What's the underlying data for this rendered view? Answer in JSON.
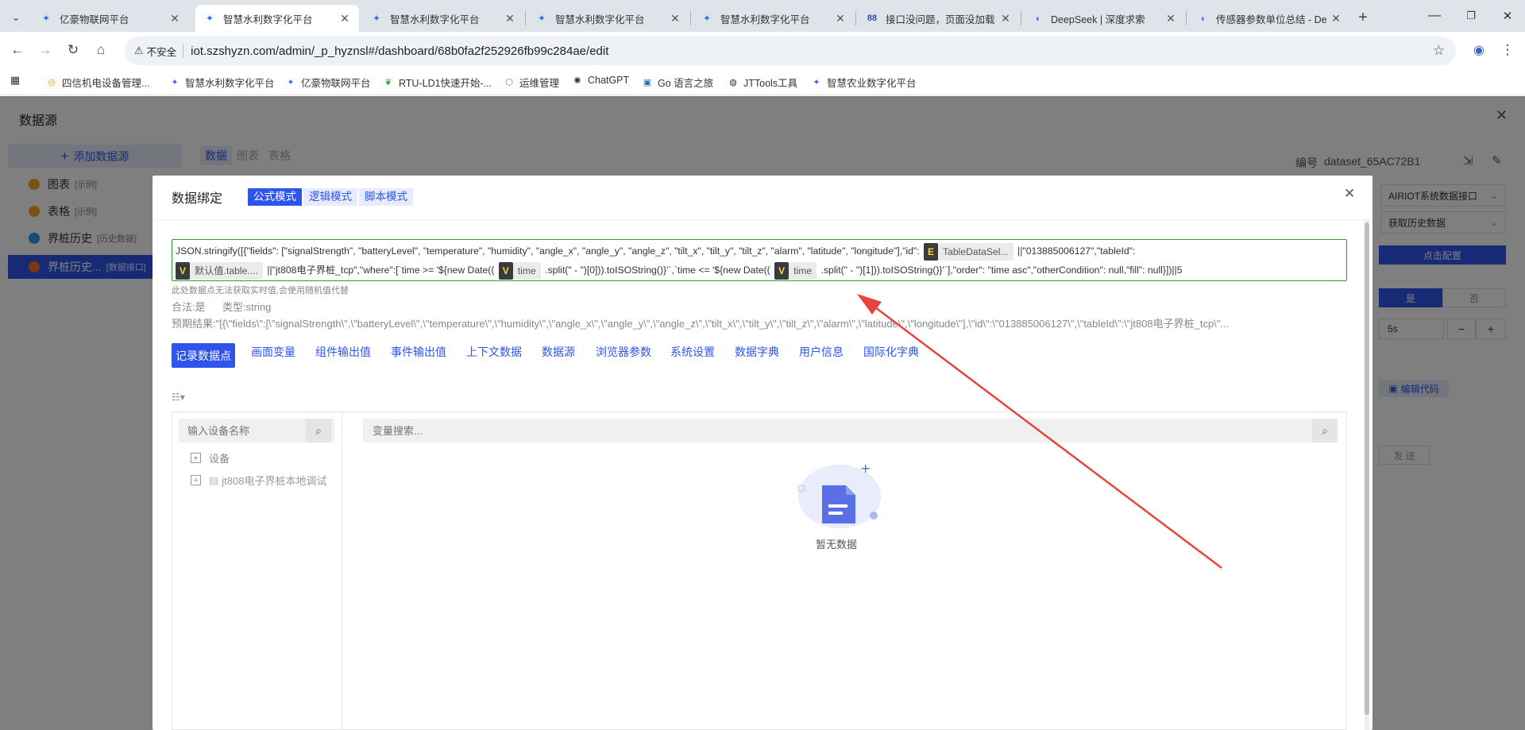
{
  "browser": {
    "tabs": [
      {
        "title": "亿豪物联网平台",
        "icon": "dashboard-logo-icon",
        "active": false
      },
      {
        "title": "智慧水利数字化平台",
        "icon": "dashboard-logo-icon",
        "active": true
      },
      {
        "title": "智慧水利数字化平台",
        "icon": "dashboard-logo-icon",
        "active": false
      },
      {
        "title": "智慧水利数字化平台",
        "icon": "dashboard-logo-icon",
        "active": false
      },
      {
        "title": "智慧水利数字化平台",
        "icon": "dashboard-logo-icon",
        "active": false
      },
      {
        "title": "接口没问题，页面没加载",
        "icon": "88-logo-icon",
        "active": false
      },
      {
        "title": "DeepSeek | 深度求索",
        "icon": "deepseek-whale-icon",
        "active": false
      },
      {
        "title": "传感器参数单位总结 - De",
        "icon": "deepseek-whale-icon",
        "active": false
      }
    ],
    "security_label": "不安全",
    "url": "iot.szshyzn.com/admin/_p_hyznsl#/dashboard/68b0fa2f252926fb99c284ae/edit",
    "bookmarks": [
      {
        "label": "四信机电设备管理...",
        "icon": "four-faith-icon"
      },
      {
        "label": "智慧水利数字化平台",
        "icon": "dashboard-logo-icon"
      },
      {
        "label": "亿豪物联网平台",
        "icon": "dashboard-logo-icon"
      },
      {
        "label": "RTU-LD1快速开始-...",
        "icon": "leaf-icon"
      },
      {
        "label": "运维管理",
        "icon": "hexagon-icon"
      },
      {
        "label": "ChatGPT",
        "icon": "chatgpt-icon"
      },
      {
        "label": "Go 语言之旅",
        "icon": "go-gopher-icon"
      },
      {
        "label": "JTTools工具",
        "icon": "globe-icon"
      },
      {
        "label": "智慧农业数字化平台",
        "icon": "dashboard-logo-icon"
      }
    ]
  },
  "panel": {
    "title": "数据源",
    "add_button": "添加数据源",
    "items": [
      {
        "name": "图表",
        "tag": "[示例]"
      },
      {
        "name": "表格",
        "tag": "[示例]"
      },
      {
        "name": "界桩历史",
        "tag": "[历史数据]"
      },
      {
        "name": "界桩历史...",
        "tag": "[数据接口]"
      }
    ],
    "subtabs": [
      "数据",
      "图表",
      "表格"
    ],
    "right": {
      "id_label": "编号",
      "id_value": "dataset_65AC72B1",
      "interface_value": "AIRIOT系统数据接口",
      "method_value": "获取历史数据",
      "config_button": "点击配置",
      "yes_label": "是",
      "no_label": "否",
      "interval_value": "5s",
      "minus": "−",
      "plus": "+",
      "edit_code": "编辑代码",
      "send": "发 送"
    }
  },
  "modal": {
    "title": "数据绑定",
    "modes": [
      "公式模式",
      "逻辑模式",
      "脚本模式"
    ],
    "formula": {
      "l1a": "JSON.stringify([{\"fields\": [\"signalStrength\", \"batteryLevel\", \"temperature\", \"humidity\", \"angle_x\", \"angle_y\", \"angle_z\", \"tilt_x\", \"tilt_y\", \"tilt_z\", \"alarm\", \"latitude\", \"longitude\"],\"id\":",
      "chip1_badge": "E",
      "chip1_text": "TableDataSel...",
      "l1b": "||\"013885006127\",\"tableId\":",
      "chip2_badge": "V",
      "chip2_text": "默认值.table....",
      "l2a": "||\"jt808电子界桩_tcp\",\"where\":[`time >= '${new Date((",
      "chip3_badge": "V",
      "chip3_text": "time",
      "l2b": ".split(\" - \")[0])).toISOString()}'`,`time <= '${new Date((",
      "chip4_badge": "V",
      "chip4_text": "time",
      "l2c": ".split(\" - \")[1])).toISOString()}'`],\"order\": \"time asc\",\"otherCondition\": null,\"fill\": null}])||5"
    },
    "hint": "此处数据点无法获取实时值,会使用随机值代替",
    "valid_label": "合法:是",
    "type_label": "类型:string",
    "preview": "预期结果:\"[{\\\"fields\\\":[\\\"signalStrength\\\",\\\"batteryLevel\\\",\\\"temperature\\\",\\\"humidity\\\",\\\"angle_x\\\",\\\"angle_y\\\",\\\"angle_z\\\",\\\"tilt_x\\\",\\\"tilt_y\\\",\\\"tilt_z\\\",\\\"alarm\\\",\\\"latitude\\\",\\\"longitude\\\"],\\\"id\\\":\\\"013885006127\\\",\\\"tableId\\\":\\\"jt808电子界桩_tcp\\\"...",
    "var_tabs": [
      "记录数据点",
      "画面变量",
      "组件输出值",
      "事件输出值",
      "上下文数据",
      "数据源",
      "浏览器参数",
      "系统设置",
      "数据字典",
      "用户信息",
      "国际化字典"
    ],
    "device_search_placeholder": "输入设备名称",
    "tree": [
      "设备",
      "jt808电子界桩本地调试"
    ],
    "var_search_placeholder": "变量搜索...",
    "empty_text": "暂无数据"
  },
  "colors": {
    "primary": "#2f54eb",
    "formula_border": "#21a03a",
    "arrow": "#e8433f",
    "chip_badge": "#3b3b3b"
  }
}
